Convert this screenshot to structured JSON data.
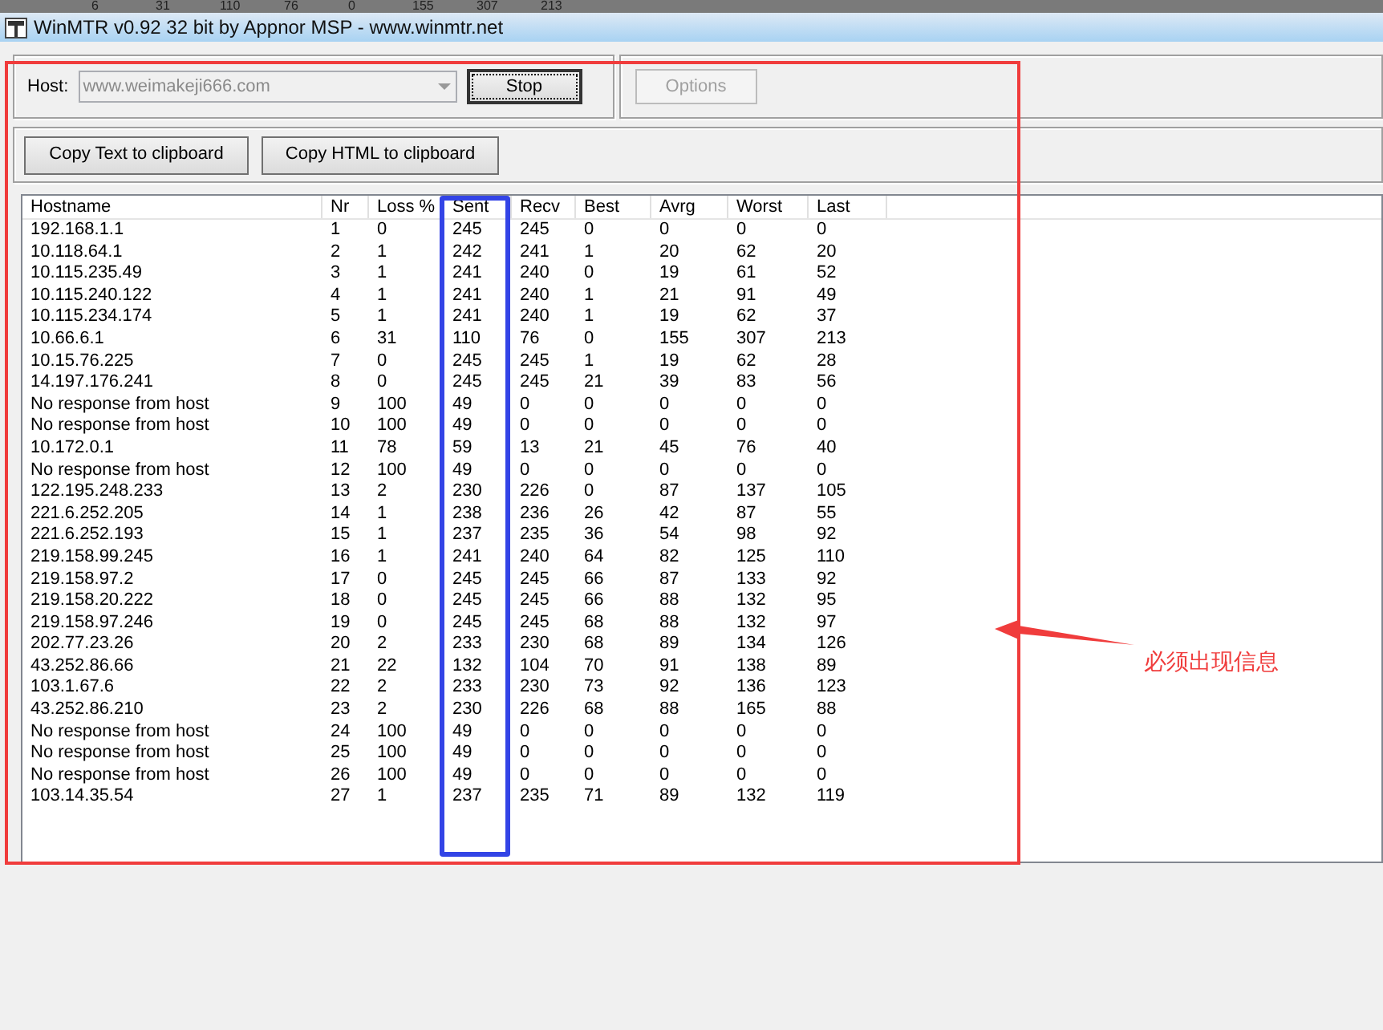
{
  "background_row": [
    "6",
    "31",
    "110",
    "76",
    "0",
    "155",
    "307",
    "213"
  ],
  "window": {
    "title": "WinMTR v0.92 32 bit by Appnor MSP - www.winmtr.net"
  },
  "host": {
    "label": "Host:",
    "value": "www.weimakeji666.com",
    "disabled": true
  },
  "buttons": [
    {
      "label": "Stop",
      "disabled": false,
      "focused": true
    },
    {
      "label": "Options",
      "disabled": true,
      "focused": false
    }
  ],
  "copy_buttons": [
    "Copy Text to clipboard",
    "Copy HTML to clipboard"
  ],
  "table": {
    "columns": [
      "Hostname",
      "Nr",
      "Loss %",
      "Sent",
      "Recv",
      "Best",
      "Avrg",
      "Worst",
      "Last"
    ],
    "rows": [
      [
        "192.168.1.1",
        "1",
        "0",
        "245",
        "245",
        "0",
        "0",
        "0",
        "0"
      ],
      [
        "10.118.64.1",
        "2",
        "1",
        "242",
        "241",
        "1",
        "20",
        "62",
        "20"
      ],
      [
        "10.115.235.49",
        "3",
        "1",
        "241",
        "240",
        "0",
        "19",
        "61",
        "52"
      ],
      [
        "10.115.240.122",
        "4",
        "1",
        "241",
        "240",
        "1",
        "21",
        "91",
        "49"
      ],
      [
        "10.115.234.174",
        "5",
        "1",
        "241",
        "240",
        "1",
        "19",
        "62",
        "37"
      ],
      [
        "10.66.6.1",
        "6",
        "31",
        "110",
        "76",
        "0",
        "155",
        "307",
        "213"
      ],
      [
        "10.15.76.225",
        "7",
        "0",
        "245",
        "245",
        "1",
        "19",
        "62",
        "28"
      ],
      [
        "14.197.176.241",
        "8",
        "0",
        "245",
        "245",
        "21",
        "39",
        "83",
        "56"
      ],
      [
        "No response from host",
        "9",
        "100",
        "49",
        "0",
        "0",
        "0",
        "0",
        "0"
      ],
      [
        "No response from host",
        "10",
        "100",
        "49",
        "0",
        "0",
        "0",
        "0",
        "0"
      ],
      [
        "10.172.0.1",
        "11",
        "78",
        "59",
        "13",
        "21",
        "45",
        "76",
        "40"
      ],
      [
        "No response from host",
        "12",
        "100",
        "49",
        "0",
        "0",
        "0",
        "0",
        "0"
      ],
      [
        "122.195.248.233",
        "13",
        "2",
        "230",
        "226",
        "0",
        "87",
        "137",
        "105"
      ],
      [
        "221.6.252.205",
        "14",
        "1",
        "238",
        "236",
        "26",
        "42",
        "87",
        "55"
      ],
      [
        "221.6.252.193",
        "15",
        "1",
        "237",
        "235",
        "36",
        "54",
        "98",
        "92"
      ],
      [
        "219.158.99.245",
        "16",
        "1",
        "241",
        "240",
        "64",
        "82",
        "125",
        "110"
      ],
      [
        "219.158.97.2",
        "17",
        "0",
        "245",
        "245",
        "66",
        "87",
        "133",
        "92"
      ],
      [
        "219.158.20.222",
        "18",
        "0",
        "245",
        "245",
        "66",
        "88",
        "132",
        "95"
      ],
      [
        "219.158.97.246",
        "19",
        "0",
        "245",
        "245",
        "68",
        "88",
        "132",
        "97"
      ],
      [
        "202.77.23.26",
        "20",
        "2",
        "233",
        "230",
        "68",
        "89",
        "134",
        "126"
      ],
      [
        "43.252.86.66",
        "21",
        "22",
        "132",
        "104",
        "70",
        "91",
        "138",
        "89"
      ],
      [
        "103.1.67.6",
        "22",
        "2",
        "233",
        "230",
        "73",
        "92",
        "136",
        "123"
      ],
      [
        "43.252.86.210",
        "23",
        "2",
        "230",
        "226",
        "68",
        "88",
        "165",
        "88"
      ],
      [
        "No response from host",
        "24",
        "100",
        "49",
        "0",
        "0",
        "0",
        "0",
        "0"
      ],
      [
        "No response from host",
        "25",
        "100",
        "49",
        "0",
        "0",
        "0",
        "0",
        "0"
      ],
      [
        "No response from host",
        "26",
        "100",
        "49",
        "0",
        "0",
        "0",
        "0",
        "0"
      ],
      [
        "103.14.35.54",
        "27",
        "1",
        "237",
        "235",
        "71",
        "89",
        "132",
        "119"
      ]
    ]
  },
  "annotation": {
    "label": "必须出现信息"
  }
}
